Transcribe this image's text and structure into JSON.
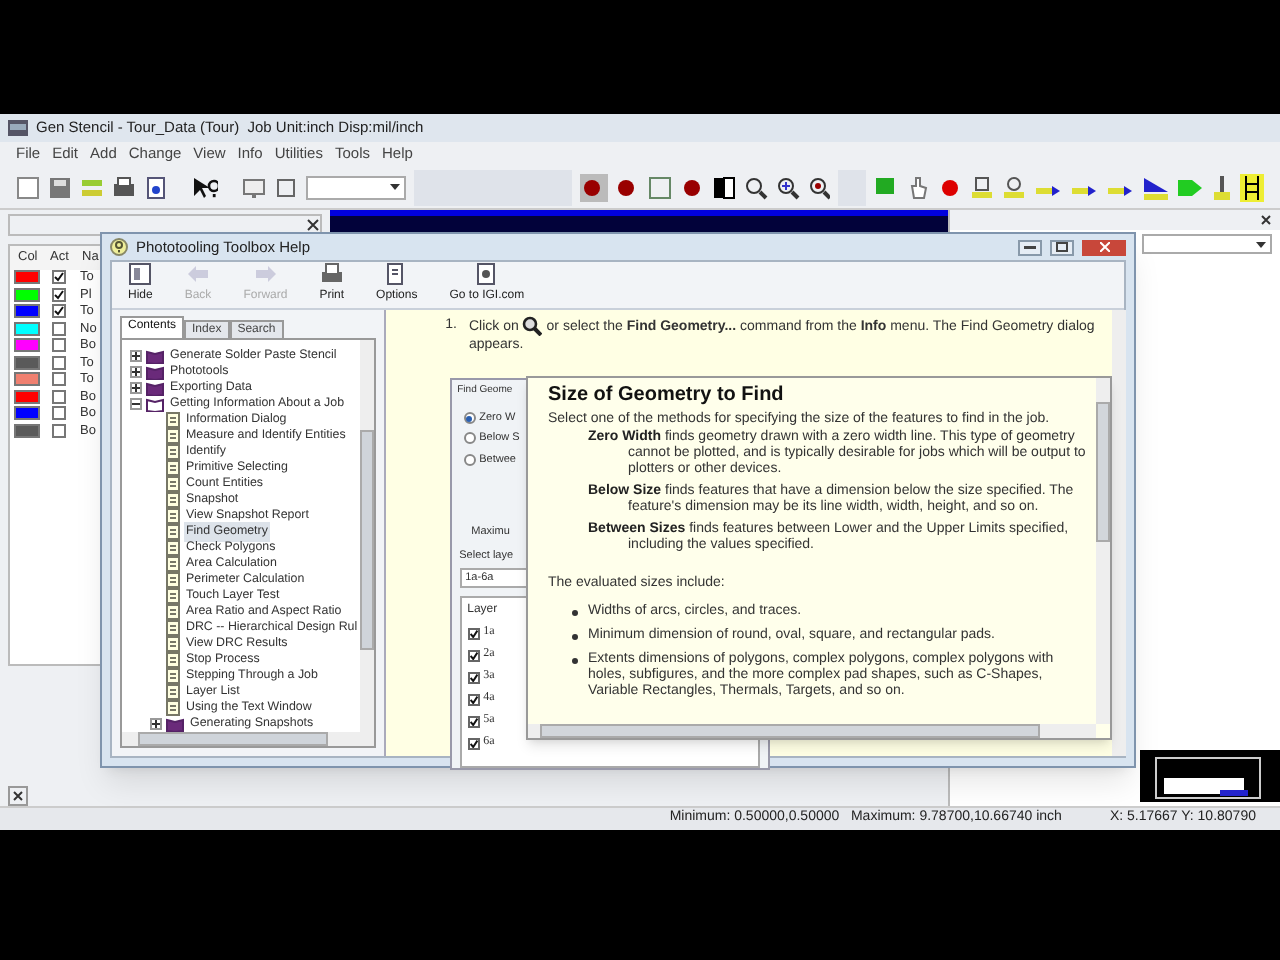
{
  "app": {
    "title": "Gen Stencil - Tour_Data (Tour)  Job Unit:inch Disp:mil/inch",
    "menu": [
      "File",
      "Edit",
      "Add",
      "Change",
      "View",
      "Info",
      "Utilities",
      "Tools",
      "Help"
    ]
  },
  "layer_panel": {
    "columns": [
      "Col",
      "Act",
      "Na"
    ],
    "layers": [
      {
        "color": "#ff0000",
        "checked": true,
        "name": "To"
      },
      {
        "color": "#00ff00",
        "checked": true,
        "name": "Pl"
      },
      {
        "color": "#0000ff",
        "checked": true,
        "name": "To"
      },
      {
        "color": "#00ffff",
        "checked": false,
        "name": "No"
      },
      {
        "color": "#ff00ff",
        "checked": false,
        "name": "Bo"
      },
      {
        "color": "#5a5a5a",
        "checked": false,
        "name": "To"
      },
      {
        "color": "#f08070",
        "checked": false,
        "name": "To"
      },
      {
        "color": "#ff0000",
        "checked": false,
        "name": "Bo"
      },
      {
        "color": "#0000ff",
        "checked": false,
        "name": "Bo"
      },
      {
        "color": "#5a5a5a",
        "checked": false,
        "name": "Bo"
      }
    ]
  },
  "status_bar": {
    "extents": "Minimum: 0.50000,0.50000   Maximum: 9.78700,10.66740 inch",
    "coordinates": "X: 5.17667 Y: 10.80790"
  },
  "help_window": {
    "title": "Phototooling Toolbox Help",
    "toolbar": [
      {
        "kind": "hide",
        "label": "Hide",
        "disabled": false
      },
      {
        "kind": "back",
        "label": "Back",
        "disabled": true
      },
      {
        "kind": "forward",
        "label": "Forward",
        "disabled": true
      },
      {
        "kind": "print",
        "label": "Print",
        "disabled": false
      },
      {
        "kind": "options",
        "label": "Options",
        "disabled": false
      },
      {
        "kind": "web",
        "label": "Go to IGI.com",
        "disabled": false
      }
    ],
    "tabs": [
      {
        "label": "Contents",
        "selected": true
      },
      {
        "label": "Index",
        "selected": false
      },
      {
        "label": "Search",
        "selected": false
      }
    ],
    "tree": [
      {
        "kind": "book",
        "label": "Generate Solder Paste Stencil",
        "expanded": false,
        "selected": false
      },
      {
        "kind": "book",
        "label": "Phototools",
        "expanded": false,
        "selected": false
      },
      {
        "kind": "book",
        "label": "Exporting Data",
        "expanded": false,
        "selected": false
      },
      {
        "kind": "book",
        "label": "Getting Information About a Job",
        "expanded": true,
        "selected": false,
        "children": [
          {
            "kind": "page",
            "label": "Information Dialog",
            "selected": false
          },
          {
            "kind": "page",
            "label": "Measure and Identify Entities",
            "selected": false
          },
          {
            "kind": "page",
            "label": "Identify",
            "selected": false
          },
          {
            "kind": "page",
            "label": "Primitive Selecting",
            "selected": false
          },
          {
            "kind": "page",
            "label": "Count Entities",
            "selected": false
          },
          {
            "kind": "page",
            "label": "Snapshot",
            "selected": false
          },
          {
            "kind": "page",
            "label": "View Snapshot Report",
            "selected": false
          },
          {
            "kind": "page",
            "label": "Find Geometry",
            "selected": true
          },
          {
            "kind": "page",
            "label": "Check Polygons",
            "selected": false
          },
          {
            "kind": "page",
            "label": "Area Calculation",
            "selected": false
          },
          {
            "kind": "page",
            "label": "Perimeter Calculation",
            "selected": false
          },
          {
            "kind": "page",
            "label": "Touch Layer Test",
            "selected": false
          },
          {
            "kind": "page",
            "label": "Area Ratio and Aspect Ratio",
            "selected": false
          },
          {
            "kind": "page",
            "label": "DRC -- Hierarchical Design Rul",
            "selected": false
          },
          {
            "kind": "page",
            "label": "View DRC Results",
            "selected": false
          },
          {
            "kind": "page",
            "label": "Stop Process",
            "selected": false
          },
          {
            "kind": "page",
            "label": "Stepping Through a Job",
            "selected": false
          },
          {
            "kind": "page",
            "label": "Layer List",
            "selected": false
          },
          {
            "kind": "page",
            "label": "Using the Text Window",
            "selected": false
          },
          {
            "kind": "book",
            "label": "Generating Snapshots",
            "expanded": false,
            "selected": false
          }
        ]
      }
    ],
    "step": {
      "number": "1.",
      "before": "Click on",
      "after": "or select the **Find Geometry...** command from the **Info** menu.  The Find Geometry dialog appears."
    },
    "dialog": {
      "title": "Find Geome",
      "options": [
        {
          "label": "Zero W",
          "selected": true
        },
        {
          "label": "Below S",
          "selected": false
        },
        {
          "label": "Betwee",
          "selected": false
        }
      ],
      "maximum_label": "Maximu",
      "select_label": "Select laye",
      "layer_field": "1a-6a",
      "layer_header": "Layer",
      "layers": [
        {
          "label": "1a",
          "checked": true
        },
        {
          "label": "2a",
          "checked": true
        },
        {
          "label": "3a",
          "checked": true
        },
        {
          "label": "4a",
          "checked": true
        },
        {
          "label": "5a",
          "checked": true
        },
        {
          "label": "6a",
          "checked": true
        }
      ]
    }
  },
  "popup": {
    "title": "Size of Geometry to Find",
    "intro": "Select one of the methods for specifying the size of the features to find in the job.",
    "definitions": [
      {
        "term": "Zero Width",
        "text": "finds geometry drawn with a zero width line. This type of geometry cannot be plotted, and is typically desirable for jobs which will be output to plotters or other devices."
      },
      {
        "term": "Below Size",
        "text": "finds features that have a dimension below the size specified. The feature's dimension may be its line width, width, height, and so on."
      },
      {
        "term": "Between Sizes",
        "text": "finds features between Lower and the Upper Limits specified, including the values specified."
      }
    ],
    "list_intro": "The evaluated sizes include:",
    "bullets": [
      "Widths of arcs, circles, and traces.",
      "Minimum dimension of round, oval, square, and rectangular pads.",
      "Extents dimensions of polygons, complex polygons, complex polygons with holes, subfigures, and the more complex pad shapes, such as C-Shapes, Variable Rectangles, Thermals, Targets, and so on."
    ]
  }
}
